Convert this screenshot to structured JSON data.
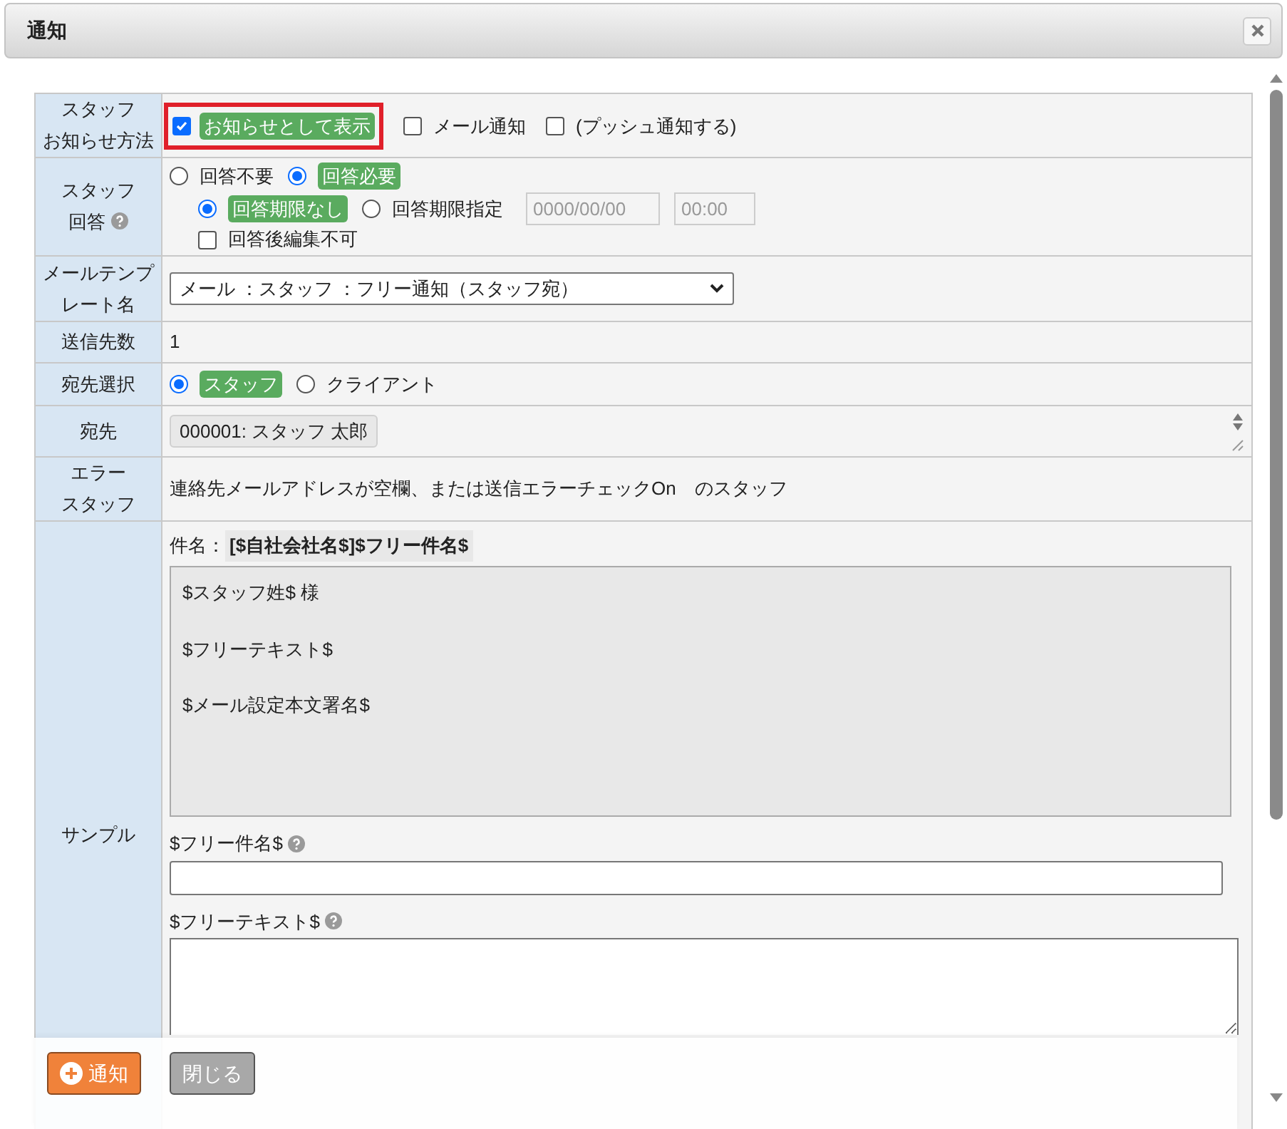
{
  "dialog": {
    "title": "通知"
  },
  "form": {
    "notice_method": {
      "label": [
        "スタッフ",
        "お知らせ方法"
      ],
      "options": [
        {
          "label": "お知らせとして表示",
          "checked": true,
          "annotated": true
        },
        {
          "label": "メール通知",
          "checked": false,
          "annotated": false
        },
        {
          "label": "(プッシュ通知する)",
          "checked": false,
          "annotated": false
        }
      ]
    },
    "answer": {
      "label": [
        "スタッフ",
        "回答"
      ],
      "help": true,
      "modes": [
        {
          "label": "回答不要",
          "selected": false
        },
        {
          "label": "回答必要",
          "selected": true
        }
      ],
      "deadline": [
        {
          "label": "回答期限なし",
          "selected": true
        },
        {
          "label": "回答期限指定",
          "selected": false
        }
      ],
      "date": {
        "placeholder": "0000/00/00"
      },
      "time": {
        "placeholder": "00:00"
      },
      "no_edit": {
        "label": "回答後編集不可",
        "checked": false
      }
    },
    "template": {
      "label": [
        "メールテンプ",
        "レート名"
      ],
      "value": "メール ：スタッフ ：フリー通知（スタッフ宛）"
    },
    "count": {
      "label": [
        "送信先数"
      ],
      "value": "1"
    },
    "recipient_type": {
      "label": [
        "宛先選択"
      ],
      "options": [
        {
          "label": "スタッフ",
          "selected": true
        },
        {
          "label": "クライアント",
          "selected": false
        }
      ]
    },
    "recipients": {
      "label": [
        "宛先"
      ],
      "items": [
        "000001: スタッフ 太郎"
      ]
    },
    "error_staff": {
      "label": [
        "エラー",
        "スタッフ"
      ],
      "text": "連絡先メールアドレスが空欄、または送信エラーチェックOn　のスタッフ"
    },
    "sample": {
      "label": [
        "サンプル"
      ],
      "subject_label": "件名：",
      "subject": "[$自社会社名$]$フリー件名$",
      "body": [
        "$スタッフ姓$ 様",
        "$フリーテキスト$",
        "$メール設定本文署名$"
      ],
      "fields": [
        {
          "label": "$フリー件名$",
          "help": true,
          "kind": "input"
        },
        {
          "label": "$フリーテキスト$",
          "help": true,
          "kind": "textarea"
        }
      ]
    }
  },
  "footer": {
    "buttons": [
      {
        "label": "通知",
        "kind": "primary"
      },
      {
        "label": "閉じる",
        "kind": "secondary"
      }
    ]
  }
}
